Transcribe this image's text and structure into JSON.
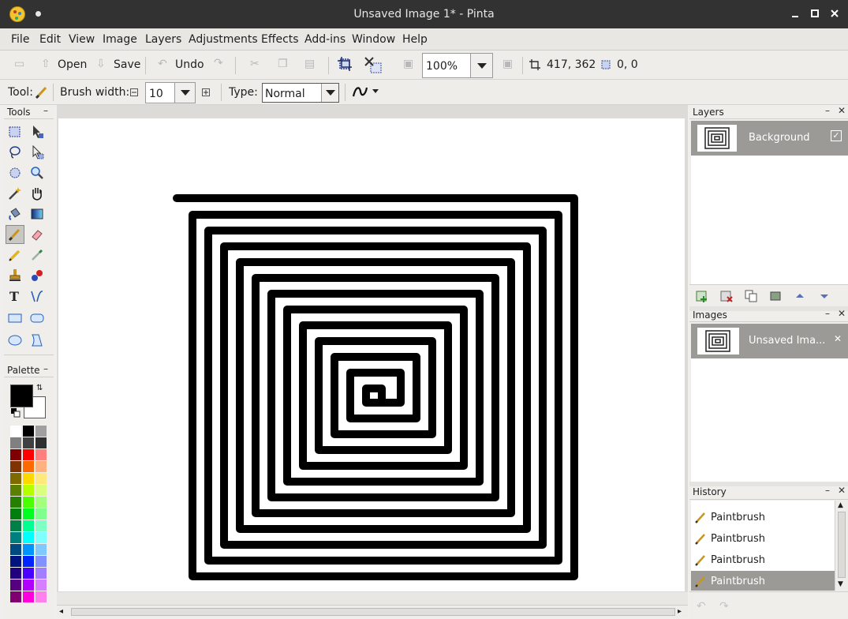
{
  "window": {
    "title": "Unsaved Image 1* - Pinta"
  },
  "menu": [
    "File",
    "Edit",
    "View",
    "Image",
    "Layers",
    "Adjustments",
    "Effects",
    "Add-ins",
    "Window",
    "Help"
  ],
  "toolbar": {
    "open_label": "Open",
    "save_label": "Save",
    "undo_label": "Undo",
    "zoom_value": "100%",
    "cursor_position": "417, 362",
    "selection_size": "0, 0"
  },
  "tool_options": {
    "tool_label": "Tool:",
    "brush_width_label": "Brush width:",
    "brush_width_value": "10",
    "type_label": "Type:",
    "type_value": "Normal"
  },
  "panels": {
    "tools_title": "Tools",
    "palette_title": "Palette",
    "layers_title": "Layers",
    "images_title": "Images",
    "history_title": "History"
  },
  "layers": [
    {
      "name": "Background",
      "visible": true
    }
  ],
  "images": [
    {
      "name": "Unsaved Ima..."
    }
  ],
  "history": [
    {
      "label": "Paintbrush",
      "selected": false
    },
    {
      "label": "Paintbrush",
      "selected": false
    },
    {
      "label": "Paintbrush",
      "selected": false
    },
    {
      "label": "Paintbrush",
      "selected": true
    }
  ],
  "colors": {
    "primary": "#000000",
    "secondary": "#ffffff",
    "accent_selected": "#9b9a97"
  },
  "palette_colors": [
    [
      "#ffffff",
      "#000000",
      "#a0a0a0"
    ],
    [
      "#808080",
      "#404040",
      "#303030"
    ],
    [
      "#7f0000",
      "#ff0000",
      "#ff7f7f"
    ],
    [
      "#7f3300",
      "#ff6a00",
      "#ffb27f"
    ],
    [
      "#7f6a00",
      "#ffd800",
      "#ffe97f"
    ],
    [
      "#5b7f00",
      "#b6ff00",
      "#daff7f"
    ],
    [
      "#267f00",
      "#4cff00",
      "#a5ff7f"
    ],
    [
      "#007f0e",
      "#00ff21",
      "#7fff8e"
    ],
    [
      "#007f46",
      "#00ff90",
      "#7fffc5"
    ],
    [
      "#007f7f",
      "#00ffff",
      "#7fffff"
    ],
    [
      "#004a7f",
      "#0094ff",
      "#7fc9ff"
    ],
    [
      "#00137f",
      "#0026ff",
      "#7f92ff"
    ],
    [
      "#21007f",
      "#4800ff",
      "#a17fff"
    ],
    [
      "#57007f",
      "#b200ff",
      "#d67fff"
    ],
    [
      "#7f006e",
      "#ff00dc",
      "#ff7fed"
    ]
  ]
}
